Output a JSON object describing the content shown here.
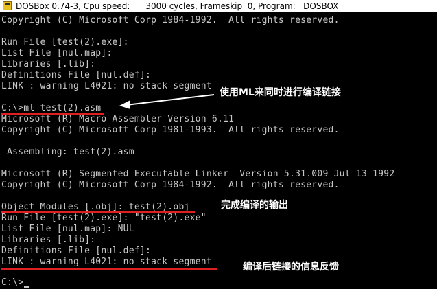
{
  "window": {
    "title": "DOSBox 0.74-3, Cpu speed:      3000 cycles, Frameskip  0, Program:   DOSBOX"
  },
  "console": {
    "lines": [
      "Copyright (C) Microsoft Corp 1984-1992.  All rights reserved.",
      "",
      "Run File [test(2).exe]:",
      "List File [nul.map]:",
      "Libraries [.lib]:",
      "Definitions File [nul.def]:",
      "LINK : warning L4021: no stack segment",
      "",
      "C:\\>ml test(2).asm",
      "Microsoft (R) Macro Assembler Version 6.11",
      "Copyright (C) Microsoft Corp 1981-1993.  All rights reserved.",
      "",
      " Assembling: test(2).asm",
      "",
      "",
      "Microsoft (R) Segmented Executable Linker  Version 5.31.009 Jul 13 1992",
      "Copyright (C) Microsoft Corp 1984-1992.  All rights reserved.",
      "",
      "Object Modules [.obj]: test(2).obj",
      "Run File [test(2).exe]: \"test(2).exe\"",
      "List File [nul.map]: NUL",
      "Libraries [.lib]:",
      "Definitions File [nul.def]:",
      "LINK : warning L4021: no stack segment",
      "",
      "C:\\>"
    ]
  },
  "annotations": {
    "ml_command": "使用ML来同时进行编译链接",
    "compile_output": "完成编译的输出",
    "link_feedback": "编译后链接的信息反馈"
  },
  "colors": {
    "text": "#c8c8c8",
    "background": "#000000",
    "underline": "#e02020",
    "annotation": "#ffffff"
  }
}
